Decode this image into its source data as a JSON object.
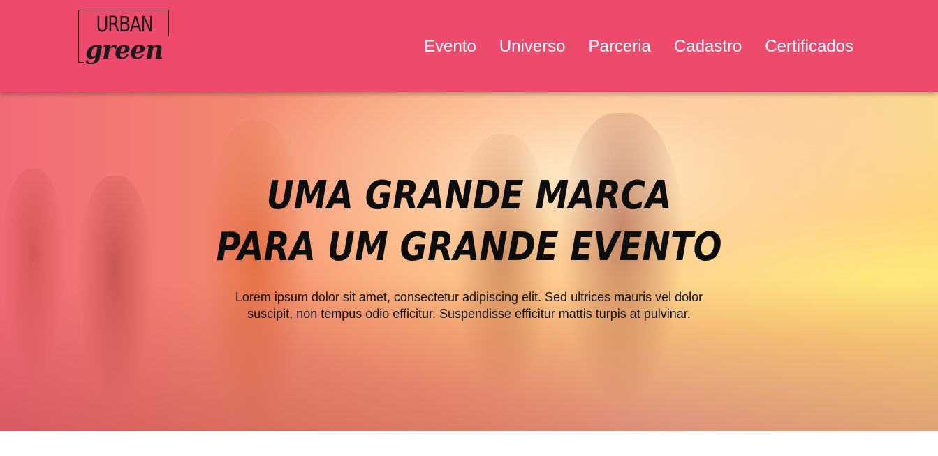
{
  "brand": {
    "logo_top": "URBAN",
    "logo_bottom": "green"
  },
  "nav": {
    "items": [
      {
        "label": "Evento"
      },
      {
        "label": "Universo"
      },
      {
        "label": "Parceria"
      },
      {
        "label": "Cadastro"
      },
      {
        "label": "Certificados"
      }
    ]
  },
  "hero": {
    "title_line1": "UMA GRANDE MARCA",
    "title_line2": "PARA UM GRANDE EVENTO",
    "text_line1": "Lorem ipsum dolor sit amet, consectetur adipiscing elit. Sed ultrices mauris vel dolor",
    "text_line2": "suscipit, non tempus odio efficitur. Suspendisse efficitur mattis turpis at pulvinar."
  },
  "colors": {
    "header_bg": "#ee4a6e",
    "nav_text": "#ffffff",
    "title_text": "#0d0d0d"
  }
}
